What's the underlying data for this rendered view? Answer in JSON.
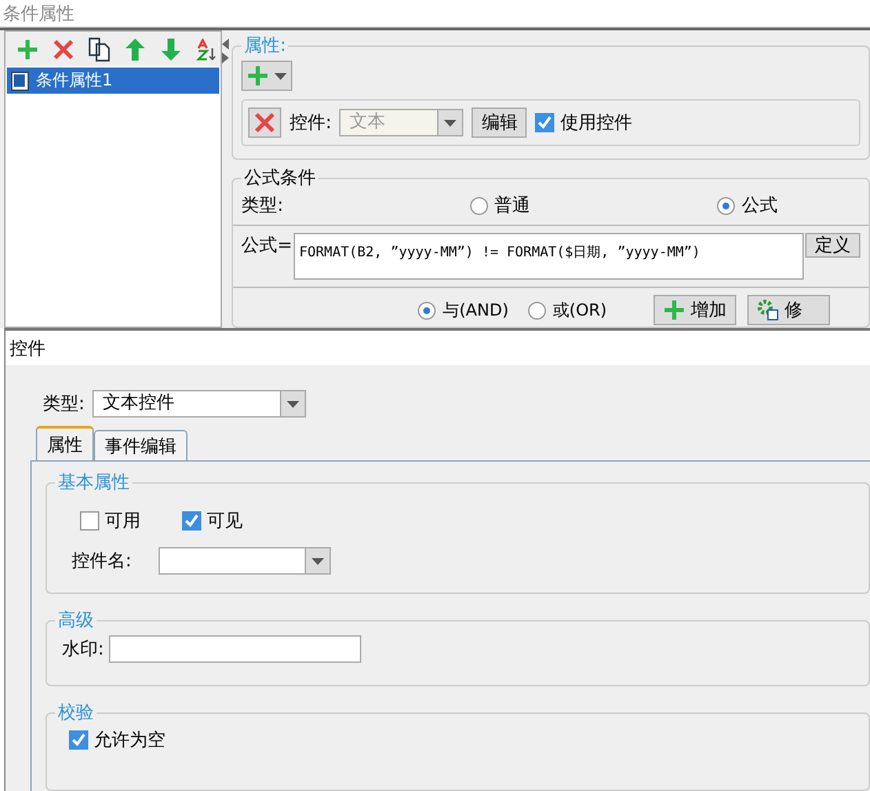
{
  "window": {
    "title": "条件属性"
  },
  "conditions": [
    {
      "label": "条件属性1",
      "selected": true
    }
  ],
  "properties": {
    "title": "属性:",
    "control_label": "控件:",
    "control_value": "文本",
    "edit_button": "编辑",
    "use_control": {
      "label": "使用控件",
      "checked": true
    }
  },
  "formula_condition": {
    "title": "公式条件",
    "type_label": "类型:",
    "types": [
      {
        "label": "普通",
        "selected": false
      },
      {
        "label": "公式",
        "selected": true
      }
    ],
    "formula_label": "公式=",
    "formula": "FORMAT(B2, ”yyyy-MM”) != FORMAT($日期, ”yyyy-MM”)",
    "define_button": "定义",
    "logic": [
      {
        "label": "与(AND)",
        "selected": true
      },
      {
        "label": "或(OR)",
        "selected": false
      }
    ],
    "add_button": "增加",
    "modify_button": "修"
  },
  "control_dialog": {
    "title": "控件",
    "type_label": "类型:",
    "type_value": "文本控件",
    "tabs": [
      {
        "label": "属性",
        "selected": true
      },
      {
        "label": "事件编辑",
        "selected": false
      }
    ],
    "basic": {
      "title": "基本属性",
      "checks": [
        {
          "label": "可用",
          "checked": false
        },
        {
          "label": "可见",
          "checked": true
        }
      ],
      "name_label": "控件名:"
    },
    "advanced": {
      "title": "高级",
      "watermark_label": "水印:"
    },
    "validation": {
      "title": "校验",
      "checks": [
        {
          "label": "允许为空",
          "checked": true
        }
      ]
    }
  }
}
